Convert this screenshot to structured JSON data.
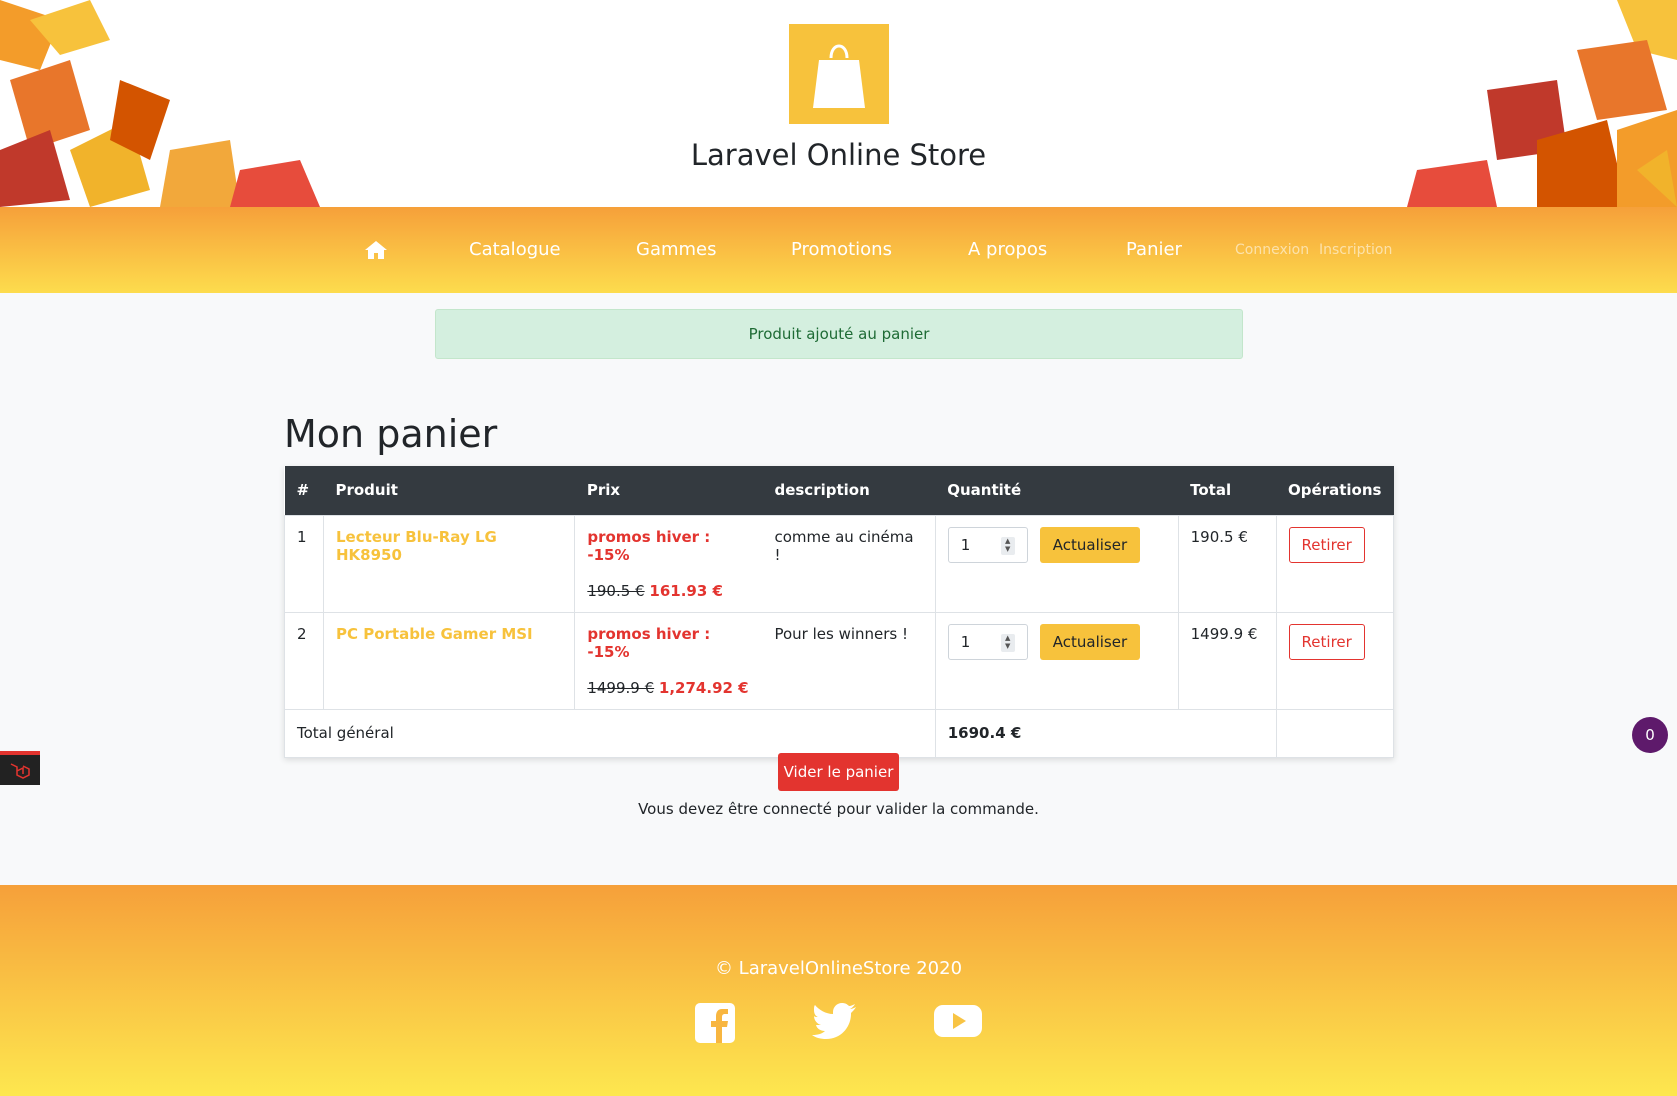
{
  "header": {
    "site_title": "Laravel Online Store",
    "logo_icon": "shopping-bag-icon",
    "brand_color": "#f7c23c"
  },
  "nav": {
    "home_icon": "home-icon",
    "items": [
      "Catalogue",
      "Gammes",
      "Promotions",
      "A propos",
      "Panier"
    ],
    "login": "Connexion",
    "register": "Inscription"
  },
  "alert": {
    "message": "Produit ajouté au panier"
  },
  "cart": {
    "heading": "Mon panier",
    "columns": [
      "#",
      "Produit",
      "Prix",
      "description",
      "Quantité",
      "Total",
      "Opérations"
    ],
    "rows": [
      {
        "index": "1",
        "product": "Lecteur Blu-Ray LG HK8950",
        "promo": "promos hiver : -15%",
        "old_price": "190.5 €",
        "new_price": "161.93 €",
        "description": "comme au cinéma !",
        "quantity": "1",
        "update_label": "Actualiser",
        "total": "190.5 €",
        "remove_label": "Retirer"
      },
      {
        "index": "2",
        "product": "PC Portable Gamer MSI",
        "promo": "promos hiver : -15%",
        "old_price": "1499.9 €",
        "new_price": "1,274.92 €",
        "description": "Pour les winners !",
        "quantity": "1",
        "update_label": "Actualiser",
        "total": "1499.9 €",
        "remove_label": "Retirer"
      }
    ],
    "grand_total_label": "Total général",
    "grand_total": "1690.4 €",
    "empty_button": "Vider le panier",
    "login_note": "Vous devez être connecté pour valider la commande."
  },
  "badge": {
    "count": "0"
  },
  "footer": {
    "copyright": "© LaravelOnlineStore 2020",
    "social_icons": [
      "facebook-icon",
      "twitter-icon",
      "youtube-icon"
    ]
  },
  "colors": {
    "accent_orange": "#f6a03a",
    "accent_yellow": "#fddc4d",
    "danger": "#e3342f",
    "dark": "#343a40"
  }
}
